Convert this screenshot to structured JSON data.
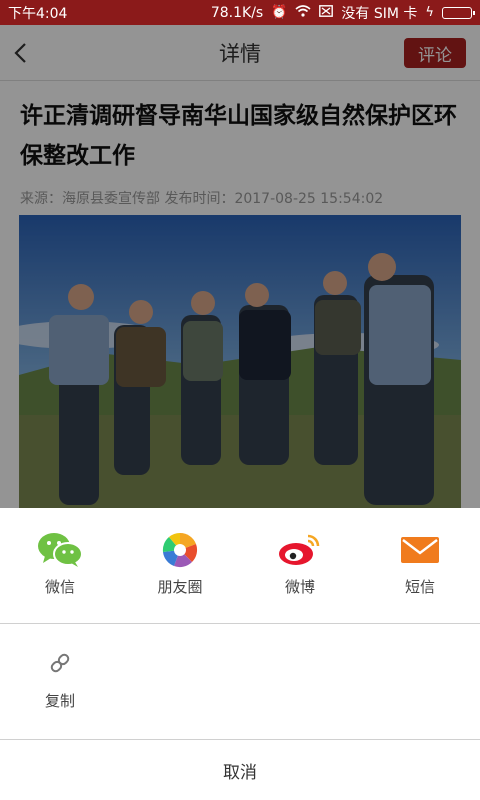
{
  "status_bar": {
    "time": "下午4:04",
    "speed": "78.1K/s",
    "no_service": "没有 SIM 卡",
    "icons": [
      "alarm-icon",
      "wifi-icon",
      "mute-icon",
      "charging-icon",
      "battery-icon"
    ]
  },
  "header": {
    "title": "详情",
    "comment_label": "评论"
  },
  "article": {
    "title": "许正清调研督导南华山国家级自然保护区环保整改工作",
    "meta": "来源：海原县委宣传部 发布时间：2017-08-25 15:54:02"
  },
  "share": {
    "items": [
      {
        "label": "微信",
        "icon": "wechat-icon"
      },
      {
        "label": "朋友圈",
        "icon": "moments-icon"
      },
      {
        "label": "微博",
        "icon": "weibo-icon"
      },
      {
        "label": "短信",
        "icon": "sms-icon"
      }
    ],
    "copy_label": "复制",
    "cancel_label": "取消"
  },
  "colors": {
    "status_bar": "#8b1a1a",
    "accent": "#a9211f",
    "wechat": "#6fc143",
    "sms": "#f07b1d",
    "weibo": "#e6162d"
  }
}
